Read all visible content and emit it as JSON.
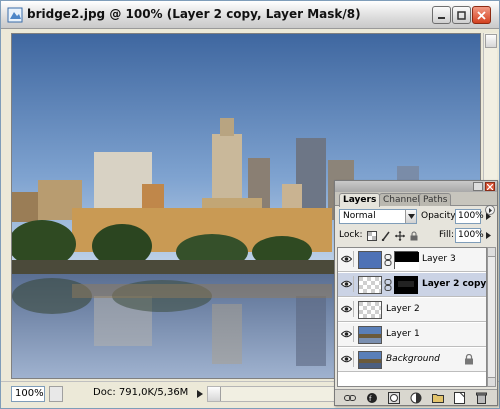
{
  "window": {
    "title": "bridge2.jpg @ 100% (Layer 2 copy, Layer Mask/8)",
    "icons": {
      "app": "photoshop-doc-icon",
      "minimize": "minimize-icon",
      "maximize": "maximize-icon",
      "close": "close-icon"
    }
  },
  "statusbar": {
    "zoom": "100%",
    "doc_info": "Doc: 791,0K/5,36M"
  },
  "layers_palette": {
    "tabs": [
      {
        "label": "Layers",
        "active": true
      },
      {
        "label": "Channels",
        "active": false
      },
      {
        "label": "Paths",
        "active": false
      }
    ],
    "blend_mode": "Normal",
    "opacity_label": "Opacity:",
    "opacity": "100%",
    "lock_label": "Lock:",
    "fill_label": "Fill:",
    "fill": "100%",
    "layers": [
      {
        "name": "Layer 3",
        "selected": false,
        "visible": true,
        "has_mask": true,
        "thumb": "blue"
      },
      {
        "name": "Layer 2 copy",
        "selected": true,
        "visible": true,
        "has_mask": true,
        "thumb": "transparent"
      },
      {
        "name": "Layer 2",
        "selected": false,
        "visible": true,
        "has_mask": false,
        "thumb": "transparent"
      },
      {
        "name": "Layer 1",
        "selected": false,
        "visible": true,
        "has_mask": false,
        "thumb": "photo"
      },
      {
        "name": "Background",
        "selected": false,
        "visible": true,
        "has_mask": false,
        "thumb": "photo",
        "locked": true
      }
    ],
    "bottom_icons": [
      "link-layers-icon",
      "layer-style-icon",
      "add-mask-icon",
      "adjustment-layer-icon",
      "new-group-icon",
      "new-layer-icon",
      "delete-layer-icon"
    ]
  },
  "colors": {
    "sky_top": "#4a6fa5",
    "sky_bottom": "#a9c4e4",
    "water": "#6e86ac",
    "selected_layer": "#cbd3e5"
  }
}
